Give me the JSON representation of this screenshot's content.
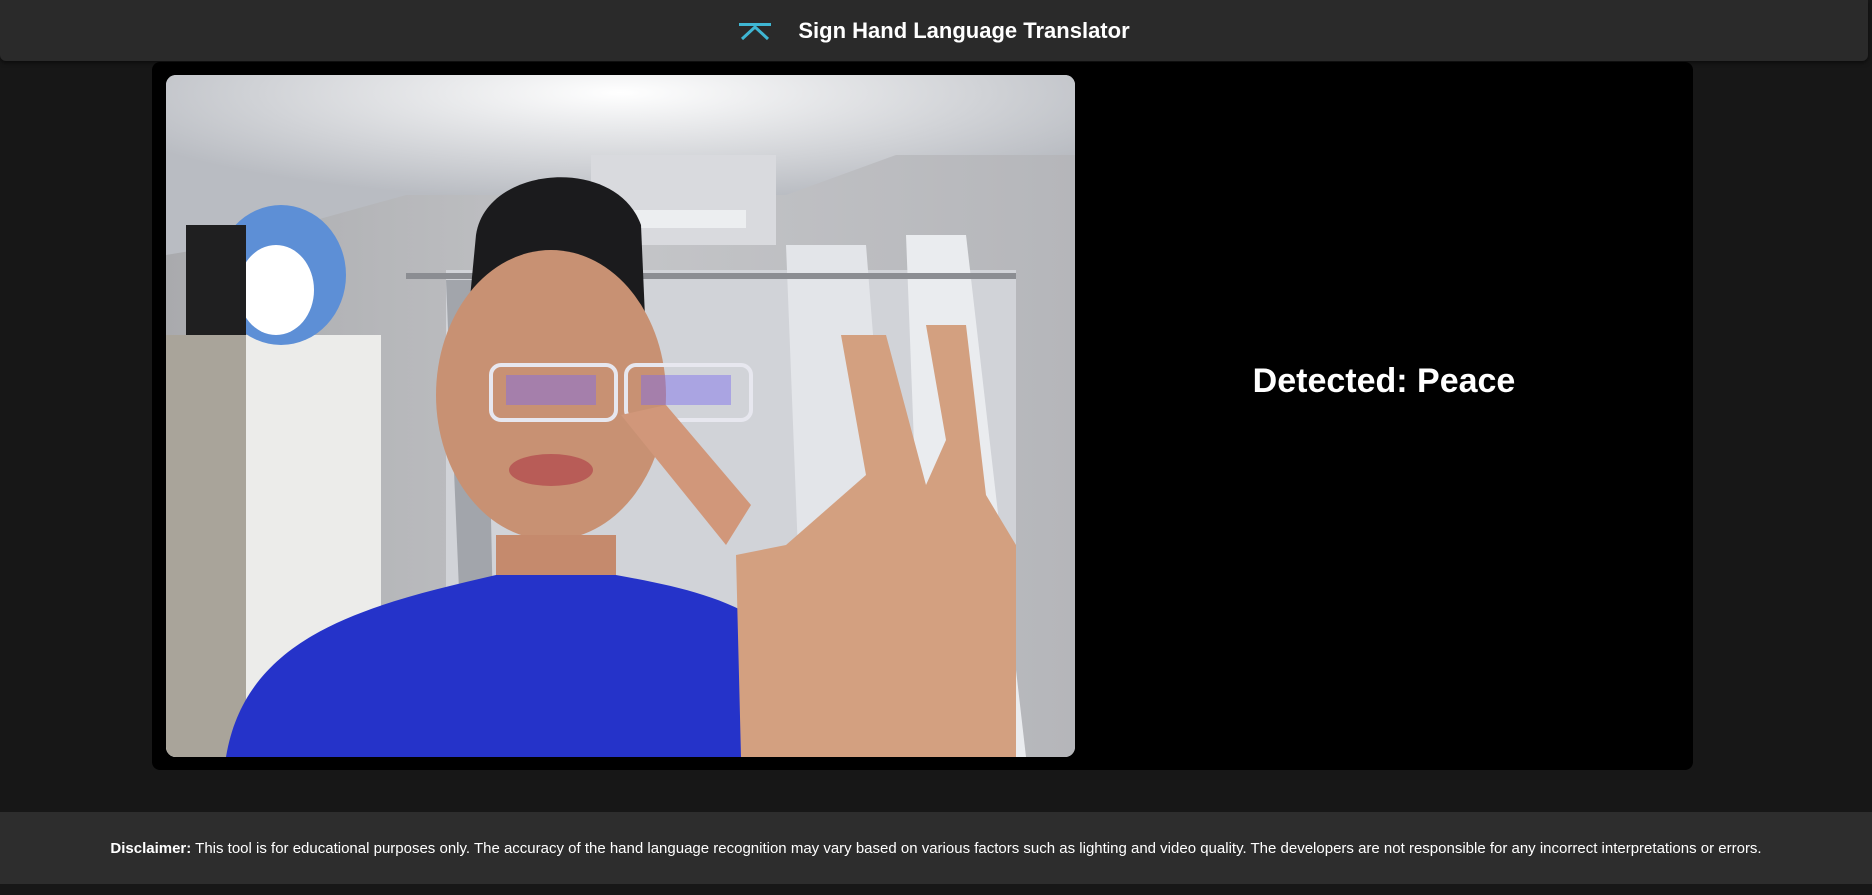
{
  "header": {
    "title": "Sign Hand Language Translator",
    "logo_icon": "hand-sign-logo-icon",
    "accent_color": "#3fb6d3"
  },
  "main": {
    "video_feed": {
      "description_icon": "webcam-video-feed"
    },
    "detection": {
      "text": "Detected: Peace"
    }
  },
  "footer": {
    "disclaimer_label": "Disclaimer:",
    "disclaimer_text": "This tool is for educational purposes only. The accuracy of the hand language recognition may vary based on various factors such as lighting and video quality. The developers are not responsible for any incorrect interpretations or errors."
  }
}
